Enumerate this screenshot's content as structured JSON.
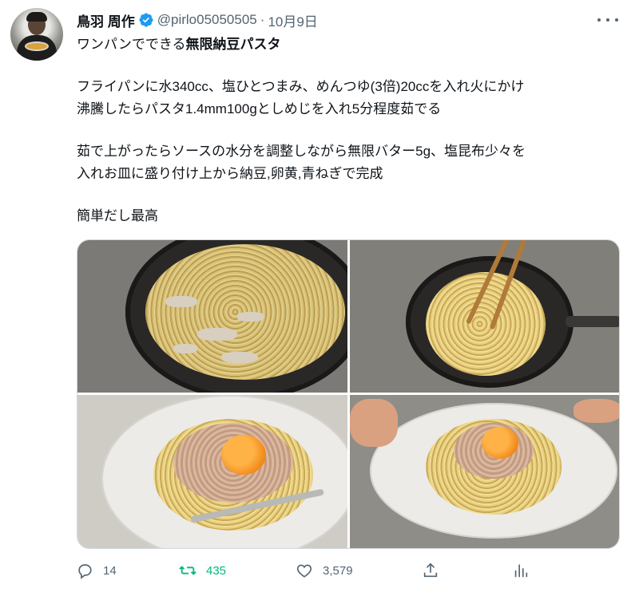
{
  "tweet": {
    "author_name": "鳥羽 周作",
    "handle": "@pirlo05050505",
    "separator": "·",
    "date": "10月9日",
    "text": {
      "line1_prefix": "ワンパンでできる",
      "line1_bold": "無限納豆パスタ",
      "line2": "フライパンに水340cc、塩ひとつまみ、めんつゆ(3倍)20ccを入れ火にかけ",
      "line3": "沸騰したらパスタ1.4mm100gとしめじを入れ5分程度茹でる",
      "line4": "茹で上がったらソースの水分を調整しながら無限バター5g、塩昆布少々を",
      "line5": "入れお皿に盛り付け上から納豆,卵黄,青ねぎで完成",
      "line6": "簡単だし最高"
    },
    "media": [
      {
        "icon": "photo-pasta-boiling"
      },
      {
        "icon": "photo-pasta-stirring"
      },
      {
        "icon": "photo-pasta-plated-closeup"
      },
      {
        "icon": "photo-pasta-plated-served"
      }
    ],
    "actions": {
      "reply_count": "14",
      "retweet_count": "435",
      "like_count": "3,579"
    },
    "colors": {
      "verified_blue": "#1d9bf0",
      "retweet_green": "#00ba7c",
      "secondary_text": "#536471"
    }
  }
}
